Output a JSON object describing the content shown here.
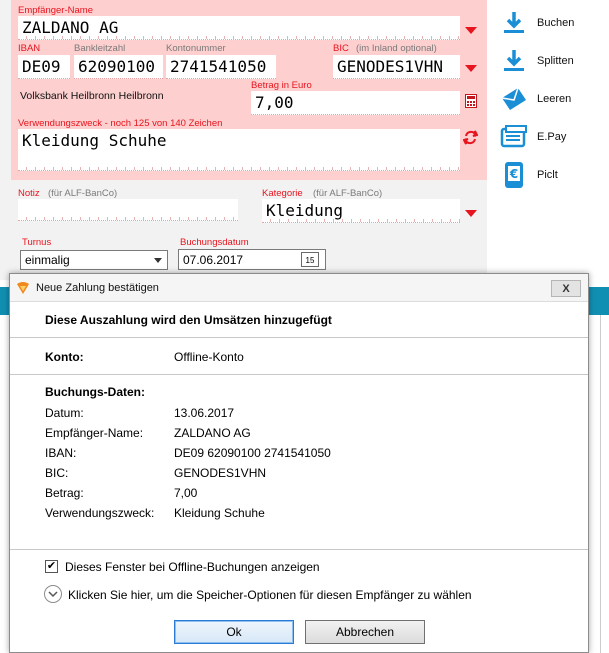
{
  "form": {
    "recipient_label": "Empfänger-Name",
    "recipient_value": "ZALDANO AG",
    "iban_label": "IBAN",
    "blz_label": "Bankleitzahl",
    "konto_label": "Kontonummer",
    "bic_label": "BIC",
    "bic_hint": "(im Inland optional)",
    "iban_country": "DE09",
    "blz_value": "62090100",
    "konto_value": "2741541050",
    "bic_value": "GENODES1VHN",
    "bank_name": "Volksbank Heilbronn Heilbronn",
    "amount_label": "Betrag in Euro",
    "amount_value": "7,00",
    "purpose_label": "Verwendungszweck - noch 125 von 140 Zeichen",
    "purpose_value": "Kleidung Schuhe",
    "note_label": "Notiz",
    "note_hint": "(für ALF-BanCo)",
    "category_label": "Kategorie",
    "category_hint": "(für ALF-BanCo)",
    "category_value": "Kleidung",
    "turnus_label": "Turnus",
    "turnus_value": "einmalig",
    "date_label": "Buchungsdatum",
    "date_value": "07.06.2017",
    "calendar_day": "15"
  },
  "sidebar": {
    "items": [
      {
        "label": "Buchen",
        "icon": "download-icon"
      },
      {
        "label": "Splitten",
        "icon": "split-download-icon"
      },
      {
        "label": "Leeren",
        "icon": "clear-envelope-icon"
      },
      {
        "label": "E.Pay",
        "icon": "epay-icon"
      },
      {
        "label": "Piclt",
        "icon": "euro-phone-icon"
      }
    ]
  },
  "dialog": {
    "title": "Neue Zahlung bestätigen",
    "close_label": "X",
    "heading": "Diese Auszahlung wird den Umsätzen hinzugefügt",
    "konto_key": "Konto:",
    "konto_value": "Offline-Konto",
    "section_title": "Buchungs-Daten:",
    "rows": [
      {
        "key": "Datum:",
        "value": "13.06.2017"
      },
      {
        "key": "Empfänger-Name:",
        "value": "ZALDANO AG"
      },
      {
        "key": "IBAN:",
        "value": "DE09 62090100 2741541050"
      },
      {
        "key": "BIC:",
        "value": "GENODES1VHN"
      },
      {
        "key": "Betrag:",
        "value": "7,00"
      },
      {
        "key": "Verwendungszweck:",
        "value": "Kleidung Schuhe"
      }
    ],
    "checkbox_label": "Dieses Fenster bei Offline-Buchungen anzeigen",
    "checkbox_checked": true,
    "expander_label": "Klicken Sie hier, um die Speicher-Optionen für diesen Empfänger zu wählen",
    "ok_label": "Ok",
    "cancel_label": "Abbrechen"
  },
  "colors": {
    "accent_red": "#e8141e",
    "pink_panel": "#fdcfcf",
    "teal": "#118fb2",
    "icon_blue": "#1a8fd6"
  }
}
